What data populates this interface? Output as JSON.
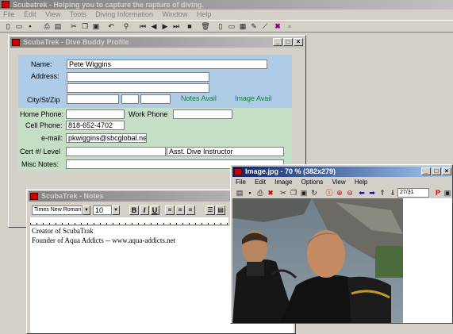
{
  "app": {
    "title": "Scubatrek - Helping you to capture the rapture of diving.",
    "menu": [
      "File",
      "Edit",
      "View",
      "Tools",
      "Diving Information",
      "Window",
      "Help"
    ]
  },
  "buddy": {
    "title": "ScubaTrek - Dive Buddy Profile",
    "labels": {
      "name": "Name:",
      "address": "Address:",
      "city": "City/St/Zip",
      "notes_avail": "Notes Avail",
      "image_avail": "Image Avail",
      "home_phone": "Home Phone:",
      "work_phone": "Work Phone",
      "cell_phone": "Cell Phone:",
      "email": "e-mail:",
      "cert": "Cert #/ Level",
      "misc": "Misc Notes:"
    },
    "values": {
      "name": "Pete Wiggins",
      "cell_phone": "818-652-4702",
      "email": "pkwiggins@sbcglobal.ne",
      "level": "Asst. Dive Instructor"
    }
  },
  "notes": {
    "title": "ScubaTrek - Notes",
    "font_name": "Times New Roman",
    "font_size": "10",
    "fmt": [
      "B",
      "I",
      "U"
    ],
    "lines": [
      "Creator of ScubaTrak",
      "Founder of Aqua Addicts -- www.aqua-addicts.net"
    ]
  },
  "image": {
    "title": "Image.jpg - 70 % (382x279)",
    "menu": [
      "File",
      "Edit",
      "Image",
      "Options",
      "View",
      "Help"
    ],
    "page": "27/31"
  }
}
